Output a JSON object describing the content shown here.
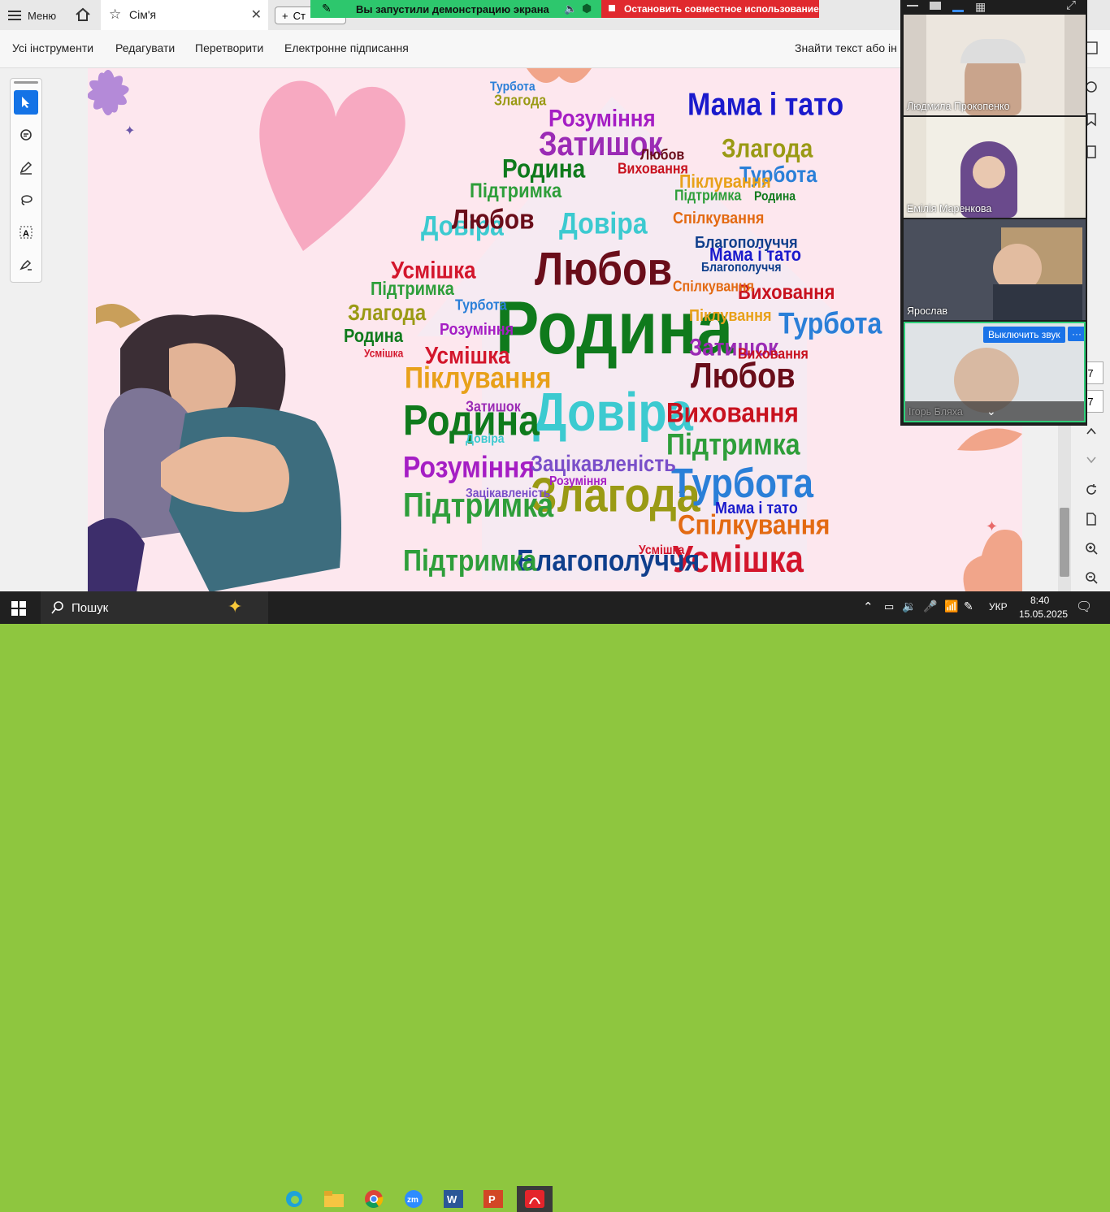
{
  "tabbar": {
    "menu_label": "Меню",
    "tab_title": "Сім'я",
    "new_tab_label": "Ст"
  },
  "toolbar": {
    "items": [
      "Усі інструменти",
      "Редагувати",
      "Перетворити",
      "Електронне підписання"
    ],
    "find_text": "Знайти текст або ін"
  },
  "screenshare": {
    "running_text": "Вы запустили демонстрацию экрана",
    "stop_text": "Остановить совместное использование"
  },
  "participants": [
    {
      "name": "Людмила Прокопенко"
    },
    {
      "name": "Емілія Маренкова"
    },
    {
      "name": "Ярослав"
    },
    {
      "name": "Ігорь Бляха",
      "mute_button": "Выключить звук"
    }
  ],
  "page_numbers": [
    "7",
    "7"
  ],
  "wordcloud": {
    "words": [
      {
        "t": "Родина",
        "c": "#0f7a1c"
      },
      {
        "t": "Любов",
        "c": "#6a0d1a"
      },
      {
        "t": "Довіра",
        "c": "#3ccad0"
      },
      {
        "t": "Мама і тато",
        "c": "#1a1acc"
      },
      {
        "t": "Затишок",
        "c": "#9b2bb5"
      },
      {
        "t": "Злагода",
        "c": "#9a9a14"
      },
      {
        "t": "Турбота",
        "c": "#2a7fd8"
      },
      {
        "t": "Підтримка",
        "c": "#2e9e3a"
      },
      {
        "t": "Піклування",
        "c": "#e8a11a"
      },
      {
        "t": "Усмішка",
        "c": "#d3162c"
      },
      {
        "t": "Виховання",
        "c": "#c8121f"
      },
      {
        "t": "Розуміння",
        "c": "#a51ec4"
      },
      {
        "t": "Благополуччя",
        "c": "#0f3f8c"
      },
      {
        "t": "Спілкування",
        "c": "#e36a12"
      },
      {
        "t": "Зацікавленість",
        "c": "#7a4fc9"
      }
    ]
  },
  "taskbar": {
    "search_label": "Пошук",
    "lang": "УКР",
    "time": "8:40",
    "date": "15.05.2025"
  }
}
